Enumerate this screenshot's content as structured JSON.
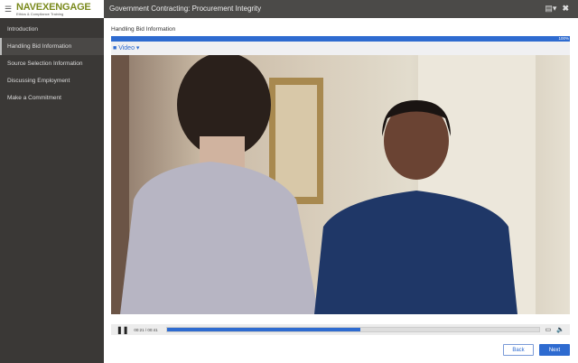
{
  "header": {
    "brand_name": "NAVEXENGAGE",
    "brand_tagline": "Ethics & Compliance Training",
    "course_title": "Government Contracting: Procurement Integrity"
  },
  "sidebar": {
    "items": [
      {
        "label": "Introduction"
      },
      {
        "label": "Handling Bid Information",
        "active": true
      },
      {
        "label": "Source Selection Information"
      },
      {
        "label": "Discussing Employment"
      },
      {
        "label": "Make a Commitment"
      }
    ]
  },
  "main": {
    "lesson_title": "Handling Bid Information",
    "progress_label": "100%",
    "progress_percent": 100,
    "tab_label": "Video"
  },
  "player": {
    "time": "00:21 / 00:41",
    "played_percent": 52
  },
  "nav": {
    "back": "Back",
    "next": "Next"
  },
  "colors": {
    "accent": "#2e6bd0",
    "header": "#4b4a48",
    "sidebar": "#3a3836"
  }
}
